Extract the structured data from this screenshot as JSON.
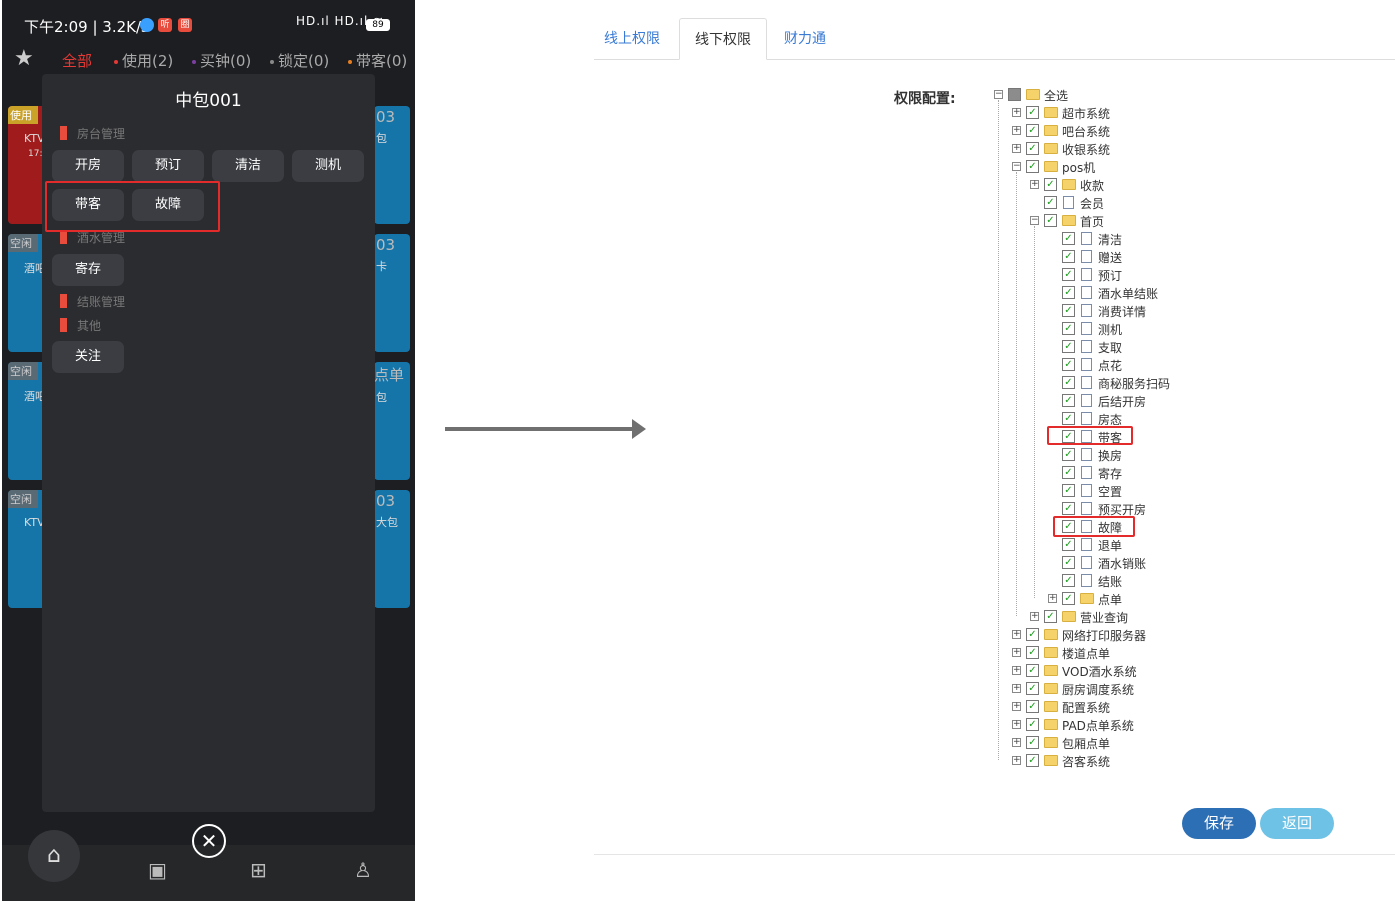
{
  "phone": {
    "status": {
      "time": "下午2:09 | 3.2K/s",
      "app2": "听",
      "app3": "圈",
      "signal": "HD.ıl HD.ıl ≋",
      "battery": "89"
    },
    "filters": [
      {
        "label": "全部",
        "color": "#e53935"
      },
      {
        "label": "使用(2)",
        "color": "#e53935"
      },
      {
        "label": "买钟(0)",
        "color": "#7b3fa0"
      },
      {
        "label": "锁定(0)",
        "color": "#888888"
      },
      {
        "label": "带客(0)",
        "color": "#e67e22"
      }
    ],
    "rooms": [
      {
        "tag": "使用",
        "line1": "KTV",
        "line2": "17:",
        "right_num": "03",
        "right_sub": "包"
      },
      {
        "tag": "空闲",
        "line1": "酒吧",
        "right_num": "03",
        "right_sub": "卡"
      },
      {
        "tag": "空闲",
        "line1": "酒吧",
        "right_num": "点单",
        "right_sub": "包"
      },
      {
        "tag": "空闲",
        "line1": "KTV",
        "right_num": "03",
        "right_sub": "大包"
      }
    ],
    "dialog": {
      "title": "中包001",
      "sections": [
        "房台管理",
        "酒水管理",
        "结账管理",
        "其他"
      ],
      "buttons": {
        "open": "开房",
        "reserve": "预订",
        "clean": "清洁",
        "test": "测机",
        "guest": "带客",
        "fault": "故障",
        "store": "寄存",
        "follow": "关注"
      }
    }
  },
  "tabs": [
    "线上权限",
    "线下权限",
    "财力通"
  ],
  "perm_label": "权限配置:",
  "tree": {
    "root": "全选",
    "top1": [
      "超市系统",
      "吧台系统",
      "收银系统"
    ],
    "pos": "pos机",
    "pos_children": {
      "collect": "收款",
      "member": "会员",
      "home": "首页"
    },
    "home_children": [
      "清洁",
      "赠送",
      "预订",
      "酒水单结账",
      "消费详情",
      "测机",
      "支取",
      "点花",
      "商秘服务扫码",
      "后结开房",
      "房态",
      "带客",
      "换房",
      "寄存",
      "空置",
      "预买开房",
      "故障",
      "退单",
      "酒水销账",
      "结账"
    ],
    "home_folder": "点单",
    "pos_tail": "营业查询",
    "top2": [
      "网络打印服务器",
      "楼道点单",
      "VOD酒水系统",
      "厨房调度系统",
      "配置系统",
      "PAD点单系统",
      "包厢点单",
      "咨客系统"
    ]
  },
  "actions": {
    "save": "保存",
    "back": "返回"
  }
}
